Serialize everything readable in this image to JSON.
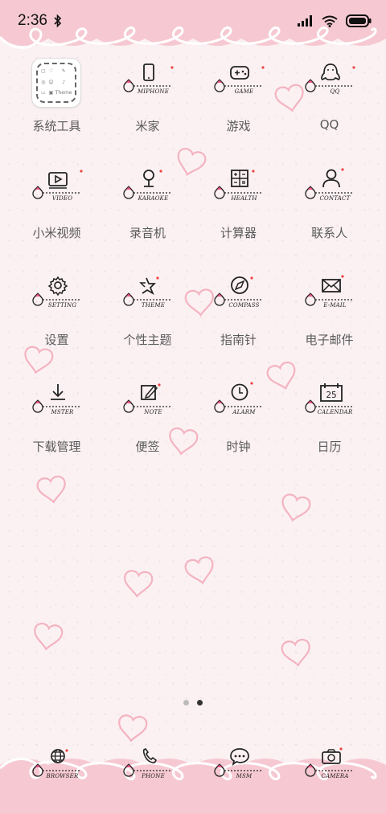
{
  "status_bar": {
    "time": "2:36",
    "icons": [
      "bluetooth-icon",
      "signal-icon",
      "wifi-icon",
      "battery-icon"
    ]
  },
  "apps": [
    {
      "label": "系统工具",
      "icon": "folder-icon",
      "doodle": ""
    },
    {
      "label": "米家",
      "icon": "phone-device-icon",
      "doodle": "MIPHONE"
    },
    {
      "label": "游戏",
      "icon": "gamepad-icon",
      "doodle": "GAME"
    },
    {
      "label": "QQ",
      "icon": "penguin-icon",
      "doodle": "QQ"
    },
    {
      "label": "小米视频",
      "icon": "video-icon",
      "doodle": "VIDEO"
    },
    {
      "label": "录音机",
      "icon": "microphone-icon",
      "doodle": "KARAOKE"
    },
    {
      "label": "计算器",
      "icon": "calculator-icon",
      "doodle": "HEALTH"
    },
    {
      "label": "联系人",
      "icon": "contact-icon",
      "doodle": "CONTACT"
    },
    {
      "label": "设置",
      "icon": "gear-icon",
      "doodle": "SETTING"
    },
    {
      "label": "个性主题",
      "icon": "star-icon",
      "doodle": "THEME"
    },
    {
      "label": "指南针",
      "icon": "compass-icon",
      "doodle": "COMPASS"
    },
    {
      "label": "电子邮件",
      "icon": "mail-icon",
      "doodle": "E-MAIL"
    },
    {
      "label": "下载管理",
      "icon": "download-icon",
      "doodle": "MSTER"
    },
    {
      "label": "便签",
      "icon": "note-icon",
      "doodle": "NOTE"
    },
    {
      "label": "时钟",
      "icon": "clock-icon",
      "doodle": "ALARM"
    },
    {
      "label": "日历",
      "icon": "calendar-icon",
      "doodle": "CALENDAR"
    }
  ],
  "folder_preview": [
    "▢",
    "♡",
    "✎",
    "◎",
    "☺",
    "♪",
    "▭",
    "▣",
    "Theme"
  ],
  "calendar_day": "25",
  "dock": [
    {
      "icon": "globe-icon",
      "doodle": "BROWSER"
    },
    {
      "icon": "phone-handset-icon",
      "doodle": "PHONE"
    },
    {
      "icon": "message-icon",
      "doodle": "MSM"
    },
    {
      "icon": "camera-icon",
      "doodle": "CAMERA"
    }
  ],
  "pages": {
    "count": 2,
    "active": 2
  },
  "colors": {
    "frill": "#f6c9d2",
    "frill_line": "#ffffff",
    "heart": "#f4b6c2",
    "background": "#fbf1f3"
  }
}
